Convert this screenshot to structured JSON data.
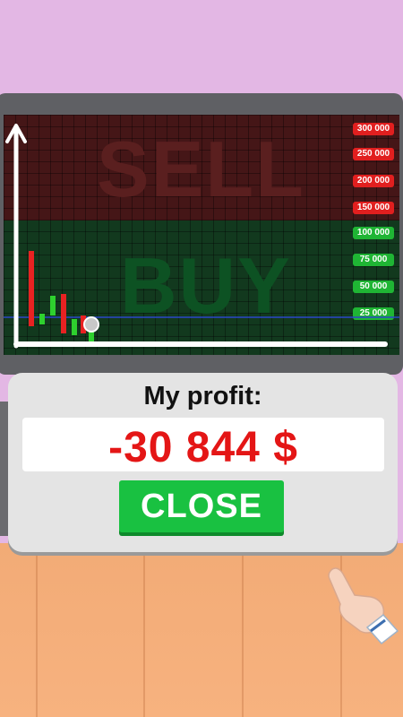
{
  "chart": {
    "zone_sell_label": "SELL",
    "zone_buy_label": "BUY",
    "price_levels": [
      {
        "label": "300 000",
        "color": "#e11f1f"
      },
      {
        "label": "250 000",
        "color": "#e11f1f"
      },
      {
        "label": "200 000",
        "color": "#e11f1f"
      },
      {
        "label": "150 000",
        "color": "#e11f1f"
      },
      {
        "label": "100 000",
        "color": "#1fb534"
      },
      {
        "label": "75 000",
        "color": "#1fb534"
      },
      {
        "label": "50 000",
        "color": "#1fb534"
      },
      {
        "label": "25 000",
        "color": "#1fb534"
      }
    ]
  },
  "panel": {
    "title": "My profit:",
    "profit_value": "-30 844 $",
    "close_label": "CLOSE"
  },
  "colors": {
    "loss": "#e41616",
    "button": "#19c141",
    "candle_up": "#2ed12e",
    "candle_down": "#e82222"
  },
  "icons": {
    "pointer": "pointing-hand-icon",
    "axis": "chart-axis-arrow-icon",
    "marker": "current-price-marker-icon"
  }
}
